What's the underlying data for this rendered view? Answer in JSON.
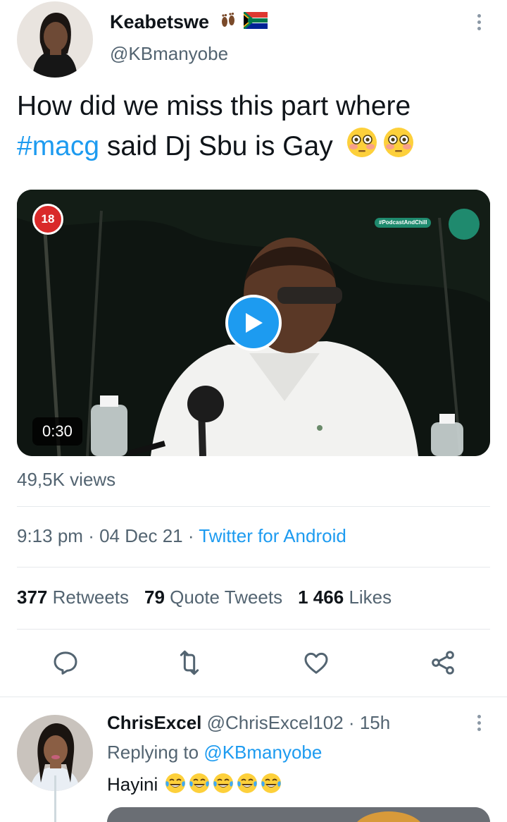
{
  "tweet": {
    "author": {
      "name": "Keabetswe",
      "name_emojis": [
        "footprints-emoji",
        "south-africa-flag-emoji"
      ],
      "handle": "@KBmanyobe"
    },
    "text_part1": "How did we miss this part where ",
    "hashtag": "#macg",
    "text_part2": " said Dj Sbu is Gay",
    "text_emojis": [
      "flushed-face-emoji",
      "flushed-face-emoji"
    ],
    "media": {
      "age_badge": "18",
      "duration": "0:30",
      "watermark": "#PodcastAndChill"
    },
    "views": "49,5K views",
    "time": "9:13 pm",
    "separator": "·",
    "date": "04 Dec 21",
    "source": "Twitter for Android",
    "stats": {
      "retweets_count": "377",
      "retweets_label": "Retweets",
      "quotes_count": "79",
      "quotes_label": "Quote Tweets",
      "likes_count": "1 466",
      "likes_label": "Likes"
    },
    "actions": [
      "reply-icon",
      "retweet-icon",
      "like-icon",
      "share-icon"
    ]
  },
  "reply": {
    "name": "ChrisExcel",
    "handle": "@ChrisExcel102",
    "separator": "·",
    "age": "15h",
    "replying_label": "Replying to",
    "replying_handle": "@KBmanyobe",
    "text": "Hayini",
    "text_emojis": [
      "tears-of-joy-emoji",
      "tears-of-joy-emoji",
      "tears-of-joy-emoji",
      "tears-of-joy-emoji",
      "tears-of-joy-emoji"
    ]
  },
  "colors": {
    "accent": "#1d9bf0",
    "secondary_text": "#536471",
    "primary_text": "#0f1419",
    "divider": "#e6e9ec"
  }
}
